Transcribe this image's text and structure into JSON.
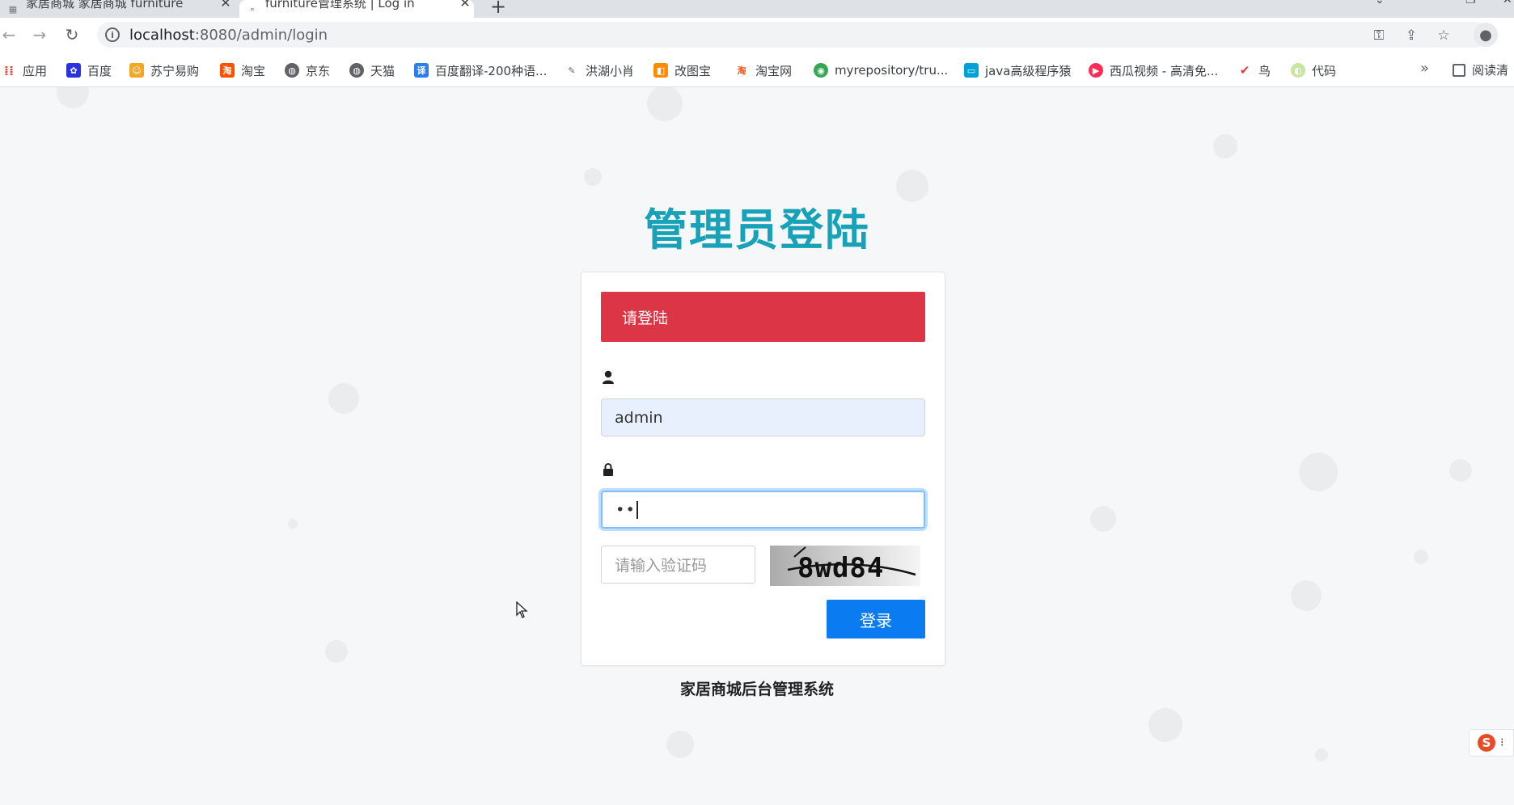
{
  "browser": {
    "tabs": [
      {
        "title": "家居商城 家居商城 furniture",
        "close": "✕"
      },
      {
        "title": "furniture管理系统 | Log in",
        "close": "✕"
      }
    ],
    "new_tab": "+",
    "url": "localhost:8080/admin/login",
    "url_host": "localhost",
    "url_path": ":8080/admin/login"
  },
  "bookmarks": [
    {
      "label": "应用",
      "icon": "apps-grid-icon",
      "color": "#4285f4"
    },
    {
      "label": "百度",
      "icon": "baidu-paw-icon",
      "color": "#2932e1"
    },
    {
      "label": "苏宁易购",
      "icon": "suning-lion-icon",
      "color": "#f5a623"
    },
    {
      "label": "淘宝",
      "icon": "taobao-icon",
      "color": "#ff5000"
    },
    {
      "label": "京东",
      "icon": "globe-icon",
      "color": "#5f6368"
    },
    {
      "label": "天猫",
      "icon": "globe-icon",
      "color": "#5f6368"
    },
    {
      "label": "百度翻译-200种语...",
      "icon": "translate-icon",
      "color": "#2b7de9"
    },
    {
      "label": "洪湖小肖",
      "icon": "bird-icon",
      "color": "#8c8c8c"
    },
    {
      "label": "改图宝",
      "icon": "gaitubao-icon",
      "color": "#ff8c00"
    },
    {
      "label": "淘宝网",
      "icon": "taobao-icon",
      "color": "#ff5000"
    },
    {
      "label": "myrepository/tru...",
      "icon": "chrome-icon",
      "color": "#34a853"
    },
    {
      "label": "java高级程序猿",
      "icon": "bilibili-icon",
      "color": "#00a1d6"
    },
    {
      "label": "西瓜视频 - 高清免...",
      "icon": "xigua-icon",
      "color": "#fe2c55"
    },
    {
      "label": "鸟",
      "icon": "bird-red-icon",
      "color": "#e53935"
    },
    {
      "label": "代码",
      "icon": "leaf-icon",
      "color": "#c8e6a0"
    }
  ],
  "bookmarks_more": "»",
  "reader_mode": "阅读清",
  "login": {
    "title": "管理员登陆",
    "alert": "请登陆",
    "username_value": "admin",
    "password_value": "••",
    "captcha_placeholder": "请输入验证码",
    "captcha_text": "8wd84",
    "submit_label": "登录",
    "footer": "家居商城后台管理系统"
  },
  "colors": {
    "title": "#17a2b8",
    "alert_bg": "#dc3545",
    "button_bg": "#0a7bf0",
    "input_autofill_bg": "#e8f0fe"
  }
}
